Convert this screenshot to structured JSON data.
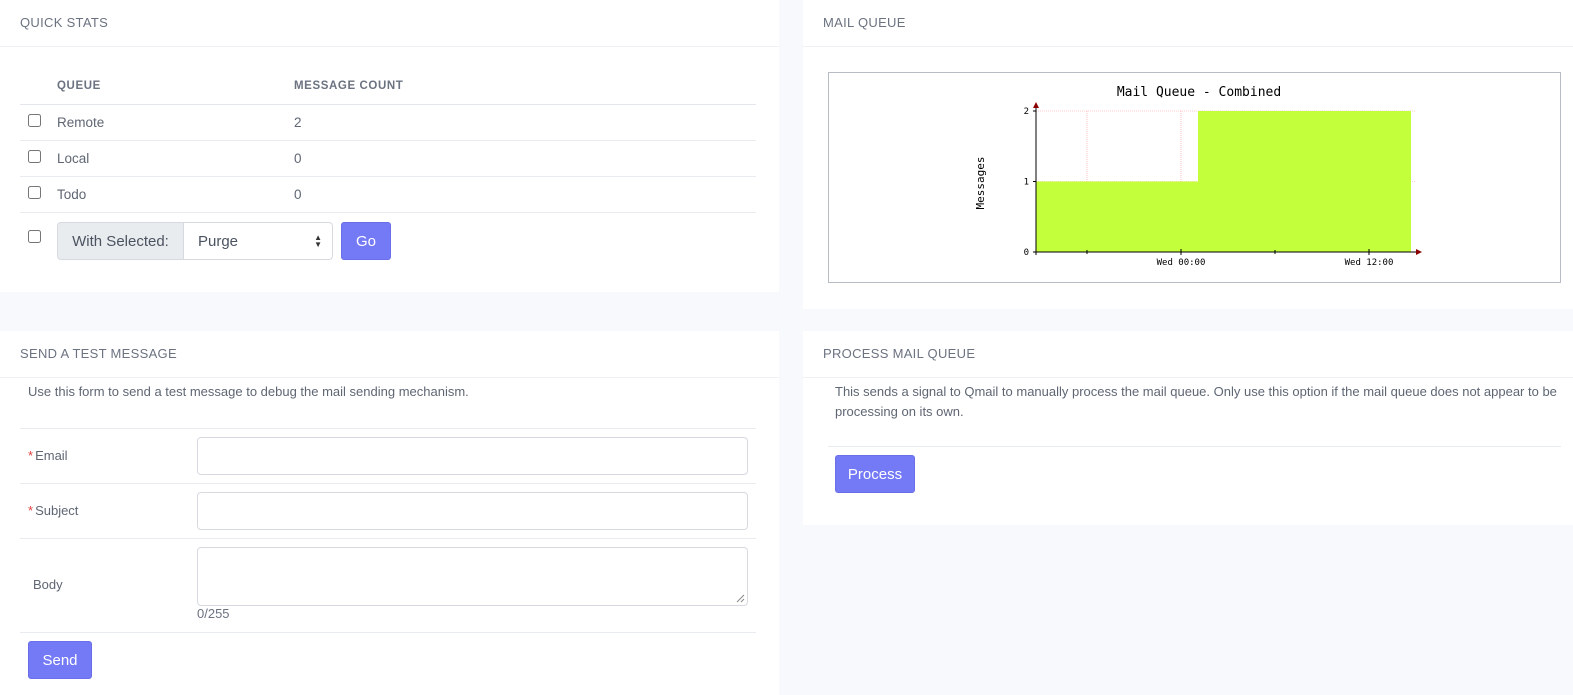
{
  "quick_stats": {
    "title": "QUICK STATS",
    "col_queue": "QUEUE",
    "col_count": "MESSAGE COUNT",
    "rows": [
      {
        "name": "Remote",
        "count": "2"
      },
      {
        "name": "Local",
        "count": "0"
      },
      {
        "name": "Todo",
        "count": "0"
      }
    ],
    "with_selected_label": "With Selected:",
    "action_selected": "Purge",
    "go_label": "Go"
  },
  "mail_queue": {
    "title": "MAIL QUEUE"
  },
  "chart_data": {
    "type": "area",
    "title": "Mail Queue - Combined",
    "ylabel": "Messages",
    "xlabel": "",
    "ylim": [
      0,
      2
    ],
    "yticks": [
      "0",
      "1",
      "2"
    ],
    "xticks": [
      "Wed 00:00",
      "Wed 12:00"
    ],
    "grid": true,
    "color": "#c4ff3c",
    "series": [
      {
        "x": [
          "start",
          "Wed 02:00",
          "Wed 02:00",
          "end"
        ],
        "values": [
          1,
          1,
          2,
          2
        ]
      }
    ]
  },
  "send_test": {
    "title": "SEND A TEST MESSAGE",
    "description": "Use this form to send a test message to debug the mail sending mechanism.",
    "email_label": "Email",
    "subject_label": "Subject",
    "body_label": "Body",
    "required_mark": "*",
    "body_counter": "0/255",
    "send_label": "Send"
  },
  "process_queue": {
    "title": "PROCESS MAIL QUEUE",
    "description": "This sends a signal to Qmail to manually process the mail queue. Only use this option if the mail queue does not appear to be processing on its own.",
    "process_label": "Process"
  }
}
